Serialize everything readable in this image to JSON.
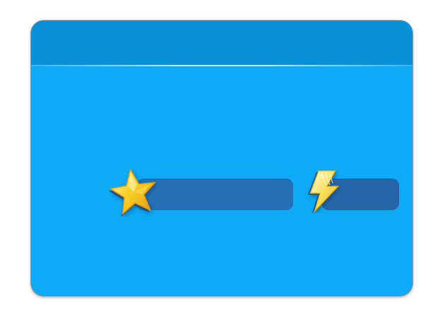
{
  "panel": {
    "header": {},
    "stats": [
      {
        "id": "stars",
        "icon": "star-icon",
        "fill": 0
      },
      {
        "id": "energy",
        "icon": "lightning-bolt-icon",
        "fill": 0
      }
    ]
  },
  "colors": {
    "panel_bg": "#0eaaf5",
    "header_bg": "#0891d8",
    "bar_bg": "#2670b5",
    "star_gold": "#f5c518",
    "bolt_yellow": "#f7d63a"
  }
}
